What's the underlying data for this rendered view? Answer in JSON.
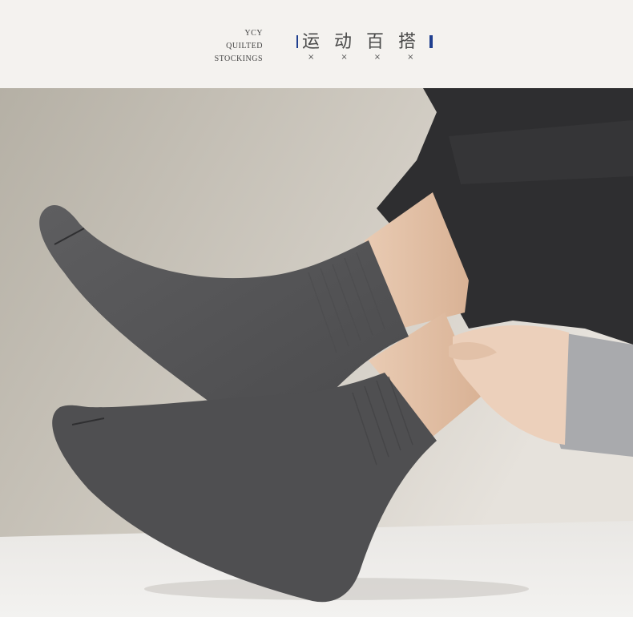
{
  "header": {
    "brand_line1": "YCY",
    "brand_line2": "QUILTED",
    "brand_line3": "STOCKINGS",
    "slogan": "运动百搭",
    "marks": "××××",
    "accent_color": "#1f3f8f"
  },
  "photo": {
    "subject": "grey-crew-socks-on-crossed-feet"
  }
}
